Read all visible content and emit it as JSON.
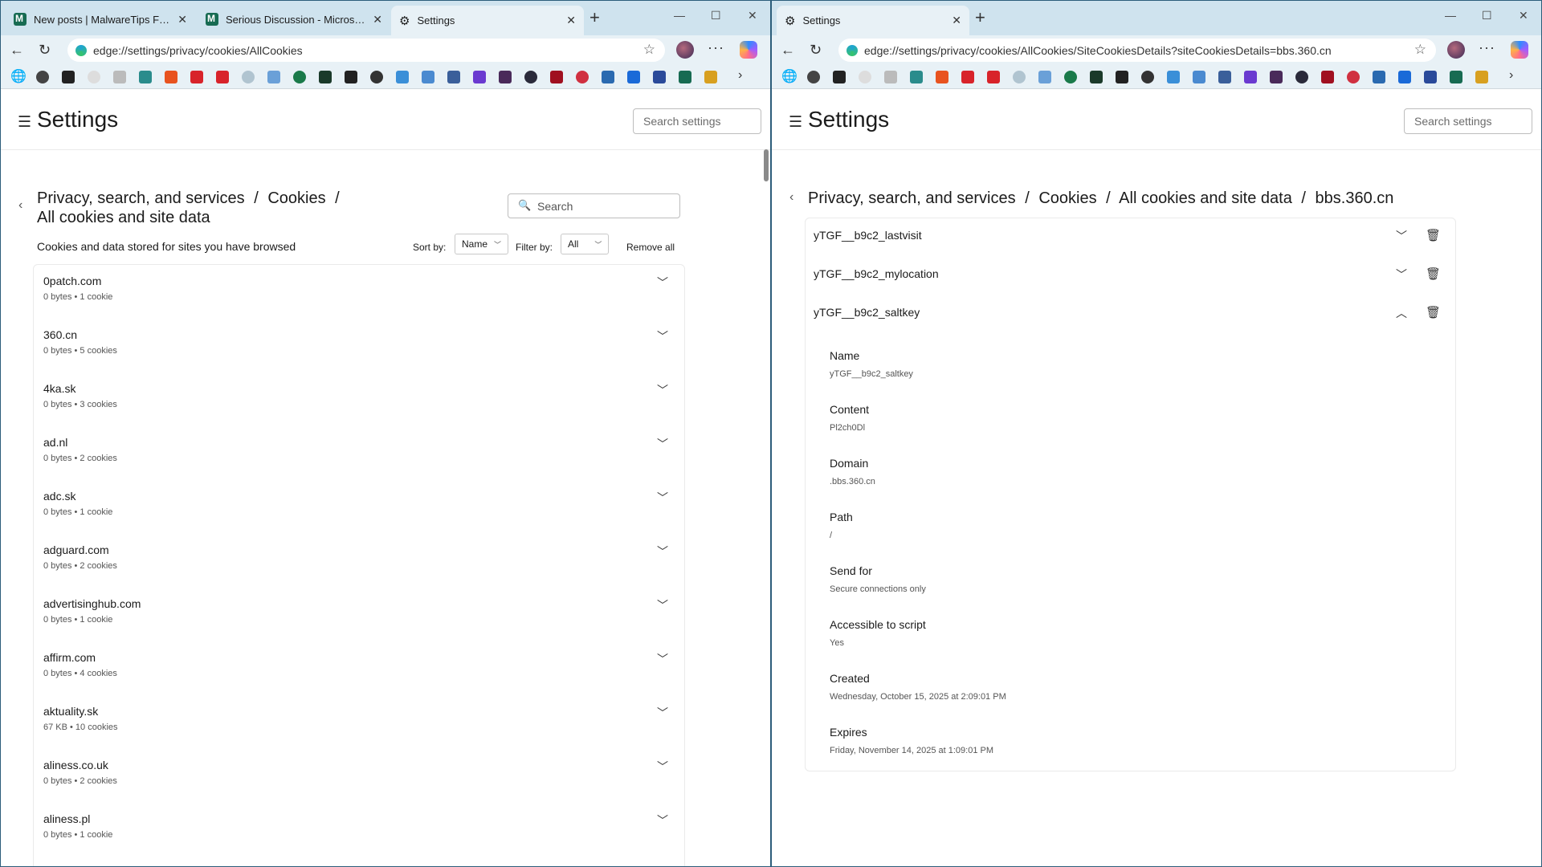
{
  "left": {
    "tabs": [
      {
        "title": "New posts | MalwareTips Forums",
        "icon": "malwaretips-icon"
      },
      {
        "title": "Serious Discussion - Microsoft Ed",
        "icon": "malwaretips-icon"
      },
      {
        "title": "Settings",
        "icon": "gear-icon"
      }
    ],
    "url": "edge://settings/privacy/cookies/AllCookies",
    "settings_title": "Settings",
    "search_settings_placeholder": "Search settings",
    "breadcrumb": {
      "part1": "Privacy, search, and services",
      "sep1": "/",
      "part2": "Cookies",
      "sep2": "/",
      "part3": "All cookies and site data"
    },
    "search_placeholder": "Search",
    "list_heading": "Cookies and data stored for sites you have browsed",
    "sort_label": "Sort by:",
    "sort_value": "Name",
    "filter_label": "Filter by:",
    "filter_value": "All",
    "remove_all": "Remove all",
    "sites": [
      {
        "name": "0patch.com",
        "meta": "0 bytes • 1 cookie"
      },
      {
        "name": "360.cn",
        "meta": "0 bytes • 5 cookies"
      },
      {
        "name": "4ka.sk",
        "meta": "0 bytes • 3 cookies"
      },
      {
        "name": "ad.nl",
        "meta": "0 bytes • 2 cookies"
      },
      {
        "name": "adc.sk",
        "meta": "0 bytes • 1 cookie"
      },
      {
        "name": "adguard.com",
        "meta": "0 bytes • 2 cookies"
      },
      {
        "name": "advertisinghub.com",
        "meta": "0 bytes • 1 cookie"
      },
      {
        "name": "affirm.com",
        "meta": "0 bytes • 4 cookies"
      },
      {
        "name": "aktuality.sk",
        "meta": "67 KB • 10 cookies"
      },
      {
        "name": "aliness.co.uk",
        "meta": "0 bytes • 2 cookies"
      },
      {
        "name": "aliness.pl",
        "meta": "0 bytes • 1 cookie"
      }
    ]
  },
  "right": {
    "tab_title": "Settings",
    "url": "edge://settings/privacy/cookies/AllCookies/SiteCookiesDetails?siteCookiesDetails=bbs.360.cn",
    "settings_title": "Settings",
    "search_settings_placeholder": "Search settings",
    "breadcrumb": {
      "part1": "Privacy, search, and services",
      "sep1": "/",
      "part2": "Cookies",
      "sep2": "/",
      "part3": "All cookies and site data",
      "sep3": "/",
      "part4": "bbs.360.cn"
    },
    "cookies": [
      {
        "name": "yTGF__b9c2_lastvisit",
        "expanded": false
      },
      {
        "name": "yTGF__b9c2_mylocation",
        "expanded": false
      },
      {
        "name": "yTGF__b9c2_saltkey",
        "expanded": true
      }
    ],
    "details": [
      {
        "label": "Name",
        "value": "yTGF__b9c2_saltkey"
      },
      {
        "label": "Content",
        "value": "Pl2ch0Dl"
      },
      {
        "label": "Domain",
        "value": ".bbs.360.cn"
      },
      {
        "label": "Path",
        "value": "/"
      },
      {
        "label": "Send for",
        "value": "Secure connections only"
      },
      {
        "label": "Accessible to script",
        "value": "Yes"
      },
      {
        "label": "Created",
        "value": "Wednesday, October 15, 2025 at 2:09:01 PM"
      },
      {
        "label": "Expires",
        "value": "Friday, November 14, 2025 at 1:09:01 PM"
      }
    ]
  },
  "colors": {
    "tabbar": "#cfe3ee",
    "toolbar": "#e8f1f6",
    "desktop": "#3a6d8c"
  }
}
